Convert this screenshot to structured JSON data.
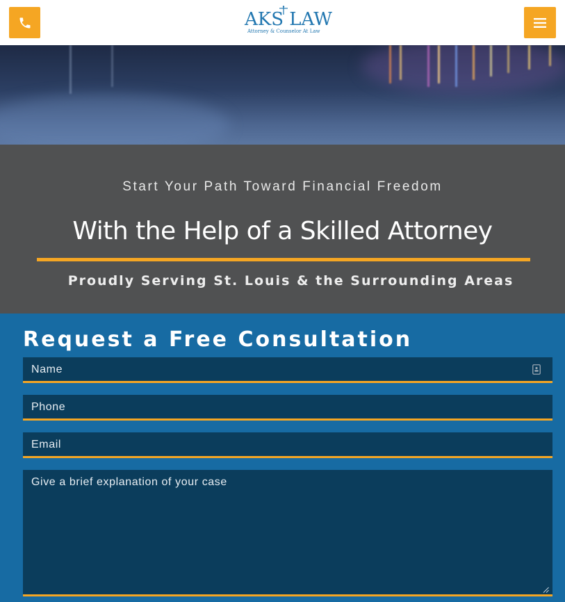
{
  "header": {
    "logo_text": "AKS LAW",
    "logo_tagline": "Attorney & Counselor At Law",
    "phone_icon": "phone-icon",
    "menu_icon": "hamburger-menu-icon",
    "accent_color": "#f5a623"
  },
  "banner": {
    "kicker": "Start Your Path Toward Financial Freedom",
    "title": "With the Help of a Skilled Attorney",
    "subtitle": "Proudly Serving St. Louis & the Surrounding Areas",
    "background_color": "#505152"
  },
  "form": {
    "title": "Request a Free Consultation",
    "background_color": "#176ba3",
    "fields": {
      "name": {
        "placeholder": "Name",
        "value": ""
      },
      "phone": {
        "placeholder": "Phone",
        "value": ""
      },
      "email": {
        "placeholder": "Email",
        "value": ""
      },
      "case": {
        "placeholder": "Give a brief explanation of your case",
        "value": ""
      }
    }
  }
}
